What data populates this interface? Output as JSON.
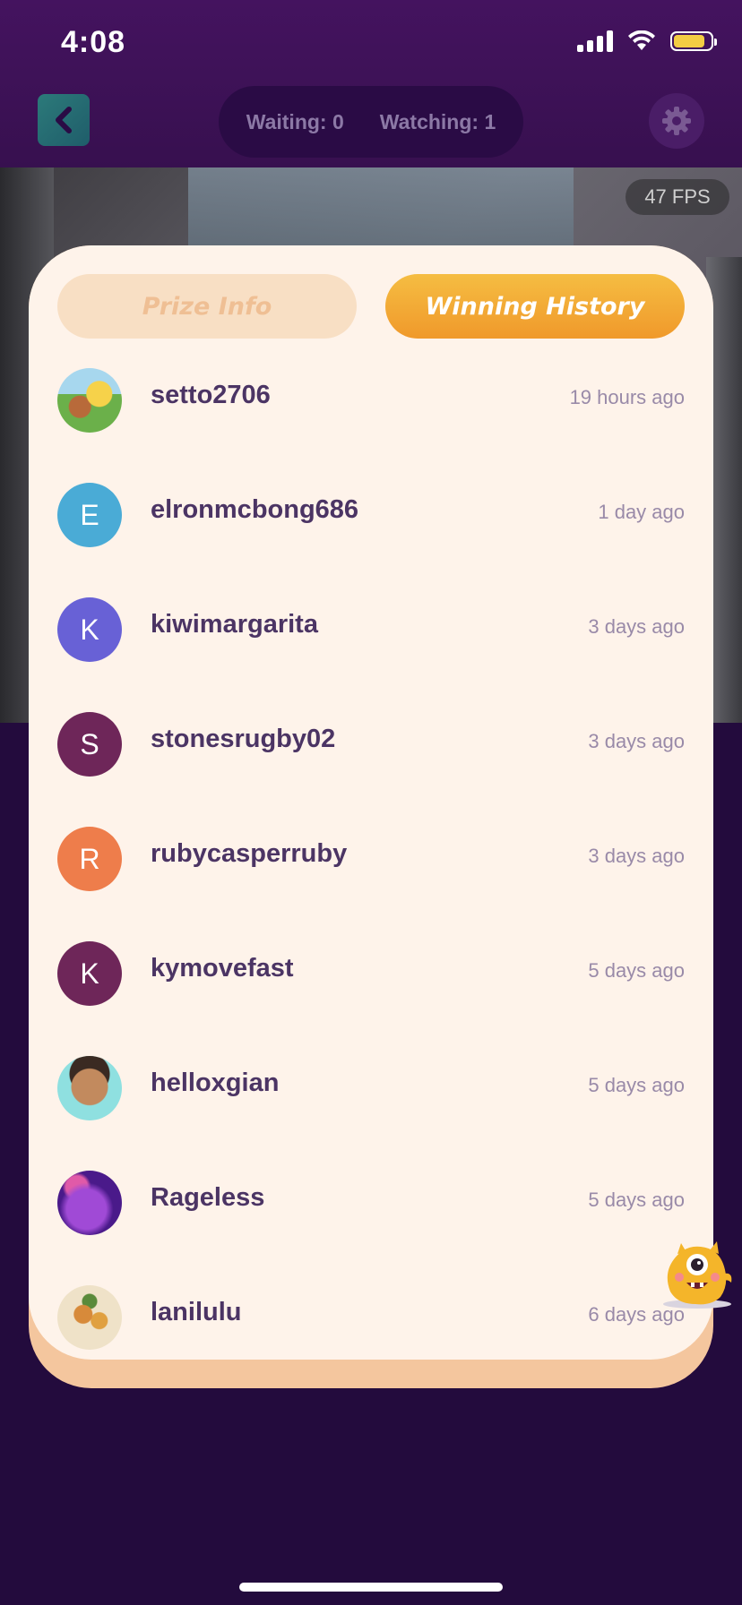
{
  "status_bar": {
    "time": "4:08"
  },
  "header": {
    "waiting_label": "Waiting: 0",
    "watching_label": "Watching: 1"
  },
  "camera": {
    "fps_label": "47 FPS"
  },
  "tabs": {
    "prize_info": "Prize Info",
    "winning_history": "Winning History",
    "active": "winning_history"
  },
  "winners": [
    {
      "username": "setto2706",
      "time_ago": "19  hours ago",
      "avatar_type": "image",
      "avatar_icon": "pokemon-avatar-icon",
      "avatar_color": "#8fc56a"
    },
    {
      "username": "elronmcbong686",
      "time_ago": "1 day ago",
      "avatar_type": "letter",
      "initial": "E",
      "avatar_color": "#4aabd6"
    },
    {
      "username": "kiwimargarita",
      "time_ago": "3 days ago",
      "avatar_type": "letter",
      "initial": "K",
      "avatar_color": "#6861d6"
    },
    {
      "username": "stonesrugby02",
      "time_ago": "3 days ago",
      "avatar_type": "letter",
      "initial": "S",
      "avatar_color": "#6e2659"
    },
    {
      "username": "rubycasperruby",
      "time_ago": "3 days ago",
      "avatar_type": "letter",
      "initial": "R",
      "avatar_color": "#ee7d4b"
    },
    {
      "username": "kymovefast",
      "time_ago": "5 days ago",
      "avatar_type": "letter",
      "initial": "K",
      "avatar_color": "#6e2659"
    },
    {
      "username": "helloxgian",
      "time_ago": "5 days ago",
      "avatar_type": "image",
      "avatar_icon": "cartoon-face-avatar-icon",
      "avatar_color": "#7fd6d6"
    },
    {
      "username": "Rageless",
      "time_ago": "5 days ago",
      "avatar_type": "image",
      "avatar_icon": "purple-photo-avatar-icon",
      "avatar_color": "#7a2aa8"
    },
    {
      "username": "lanilulu",
      "time_ago": "6 days ago",
      "avatar_type": "image",
      "avatar_icon": "food-photo-avatar-icon",
      "avatar_color": "#c79a4a"
    }
  ],
  "colors": {
    "header_bg": "#44135f",
    "page_bg": "#230b3d",
    "card_bg": "#fef3ea",
    "accent_orange": "#f0992b",
    "username_text": "#4b3464",
    "time_text": "#998aa8"
  },
  "icons": {
    "back": "chevron-left-icon",
    "settings": "gear-icon",
    "mascot": "yellow-monster-mascot-icon"
  }
}
